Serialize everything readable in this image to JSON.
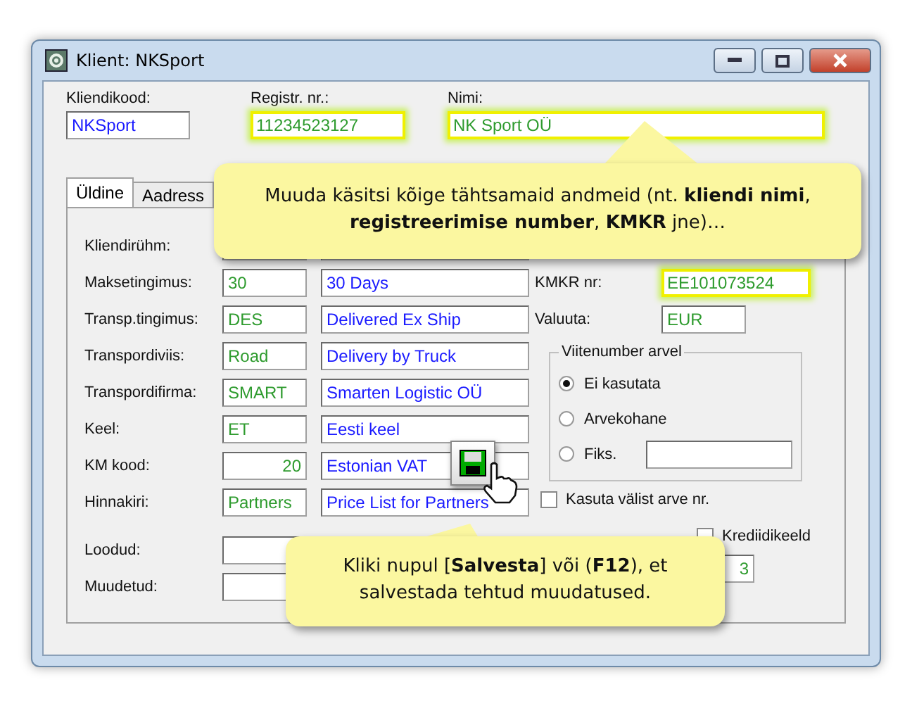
{
  "window": {
    "title": "Klient: NKSport"
  },
  "top_fields": [
    {
      "label": "Kliendikood:",
      "value": "NKSport",
      "color": "#1a1aff",
      "highlighted": false
    },
    {
      "label": "Registr. nr.:",
      "value": "11234523127",
      "color": "#2e9b2e",
      "highlighted": true
    },
    {
      "label": "Nimi:",
      "value": "NK Sport OÜ",
      "color": "#2e9b2e",
      "highlighted": true
    }
  ],
  "tabs": [
    {
      "label": "Üldine",
      "selected": true
    },
    {
      "label": "Aadress",
      "selected": false
    }
  ],
  "left_rows": [
    {
      "label": "Kliendirühm:"
    },
    {
      "label": "Maksetingimus:",
      "code": "30",
      "name": "30 Days",
      "kind": "text"
    },
    {
      "label": "Transp.tingimus:",
      "code": "DES",
      "name": "Delivered Ex Ship",
      "kind": "text"
    },
    {
      "label": "Transpordiviis:",
      "code": "Road",
      "name": "Delivery by Truck",
      "kind": "text"
    },
    {
      "label": "Transpordifirma:",
      "code": "SMART",
      "name": "Smarten Logistic OÜ",
      "kind": "text"
    },
    {
      "label": "Keel:",
      "code": "ET",
      "name": "Eesti keel",
      "kind": "text"
    },
    {
      "label": "KM kood:",
      "code": "20",
      "name": "Estonian VAT",
      "kind": "number"
    },
    {
      "label": "Hinnakiri:",
      "code": "Partners",
      "name": "Price List for Partners",
      "kind": "text"
    }
  ],
  "date_rows": [
    {
      "label": "Loodud:"
    },
    {
      "label": "Muudetud:"
    }
  ],
  "right_fields": [
    {
      "label": "KMKR nr:",
      "value": "EE101073524",
      "highlighted": true
    },
    {
      "label": "Valuuta:",
      "value": "EUR",
      "highlighted": false
    }
  ],
  "reference_group": {
    "title": "Viitenumber arvel",
    "options": [
      {
        "label": "Ei kasutata",
        "selected": true
      },
      {
        "label": "Arvekohane",
        "selected": false
      },
      {
        "label": "Fiks.",
        "selected": false
      }
    ]
  },
  "external_invoice": {
    "label": "Kasuta välist arve nr.",
    "checked": false
  },
  "credit_block": {
    "label": "Krediidikeeld",
    "checked": false
  },
  "count_value": "3",
  "callouts": [
    {
      "text": "Muuda käsitsi kõige tähtsamaid andmeid (nt. **kliendi nimi**, **registreerimise number**, **KMKR** jne)…"
    },
    {
      "text": "Kliki nupul [**Salvesta**] või (**F12**), et salvestada tehtud muudatused."
    }
  ]
}
